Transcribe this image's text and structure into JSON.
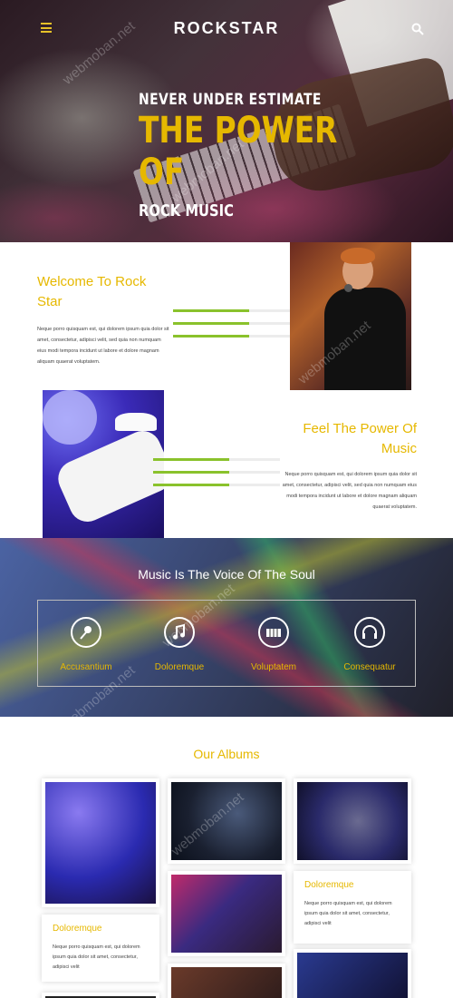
{
  "header": {
    "brand": "ROCKSTAR",
    "menu_icon": "hamburger-icon",
    "search_icon": "search-icon"
  },
  "hero": {
    "line1": "NEVER UNDER ESTIMATE",
    "line2": "THE POWER",
    "line3": "OF",
    "line4": "ROCK MUSIC"
  },
  "welcome": {
    "title": "Welcome To Rock Star",
    "text": "Neque porro quisquam est, qui dolorem ipsum quia dolor sit amet, consectetur, adipisci velit, sed quia non numquam eius modi tempora incidunt ut labore et dolore magnam aliquam quaerat voluptatem.",
    "bar_levels": [
      0.6,
      0.6,
      0.6
    ]
  },
  "feel": {
    "title": "Feel The Power Of Music",
    "text": "Neque porro quisquam est, qui dolorem ipsum quia dolor sit amet, consectetur, adipisci velit, sed quia non numquam eius modi tempora incidunt ut labore et dolore magnam aliquam quaerat voluptatem.",
    "bar_levels": [
      0.6,
      0.6,
      0.6
    ]
  },
  "soul": {
    "title": "Music Is The Voice Of The Soul",
    "features": [
      {
        "label": "Accusantium",
        "icon": "microphone-icon"
      },
      {
        "label": "Doloremque",
        "icon": "music-note-icon"
      },
      {
        "label": "Voluptatem",
        "icon": "keyboard-icon"
      },
      {
        "label": "Consequatur",
        "icon": "headphones-icon"
      }
    ]
  },
  "albums": {
    "title": "Our Albums",
    "captions": [
      {
        "title": "Doloremque",
        "text": "Neque porro quisquam est, qui dolorem ipsum quia dolor sit amet, consectetur, adipisci velit"
      },
      {
        "title": "Doloremque",
        "text": "Neque porro quisquam est, qui dolorem ipsum quia dolor sit amet, consectetur, adipisci velit"
      }
    ]
  },
  "watermark": "webmoban.net",
  "colors": {
    "accent": "#e6b800",
    "bar": "#8ac22c"
  }
}
